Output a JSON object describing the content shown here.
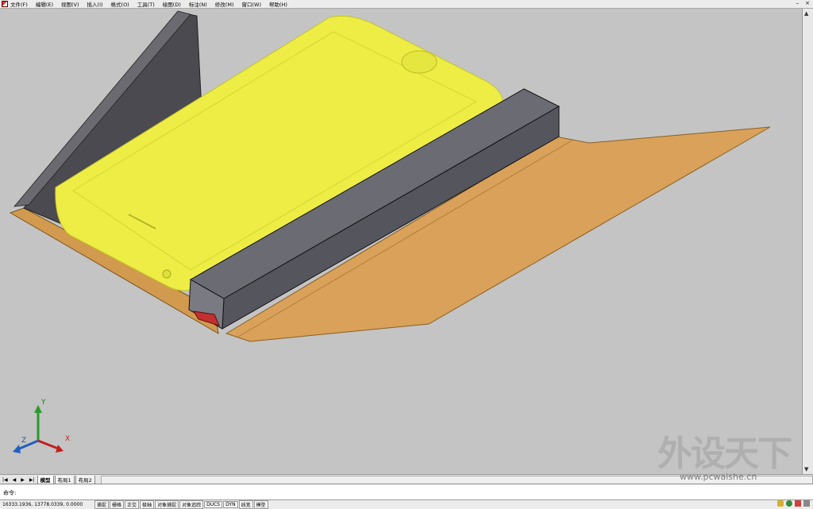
{
  "menu": [
    "文件(F)",
    "编辑(E)",
    "视图(V)",
    "插入(I)",
    "格式(O)",
    "工具(T)",
    "绘图(D)",
    "标注(N)",
    "修改(M)",
    "窗口(W)",
    "帮助(H)"
  ],
  "window_buttons": [
    "–",
    "×"
  ],
  "tabs": {
    "model": "模型",
    "layout1": "布局1",
    "layout2": "布局2"
  },
  "command": {
    "prompt": "命令:"
  },
  "status": {
    "coords": "16333.1936, 13778.0339, 0.0000",
    "modes": [
      "捕捉",
      "栅格",
      "正交",
      "极轴",
      "对象捕捉",
      "对象追踪",
      "DUCS",
      "DYN",
      "线宽",
      "模型"
    ]
  },
  "ucs": {
    "x": "X",
    "y": "Y",
    "z": "Z"
  },
  "watermark": {
    "title": "外设天下",
    "url": "www.pcwaishe.cn"
  },
  "colors": {
    "phone": "#eded45",
    "case_inner": "#dca056",
    "case_bar": "#5e5e66",
    "viewport": "#c4c4c4"
  }
}
